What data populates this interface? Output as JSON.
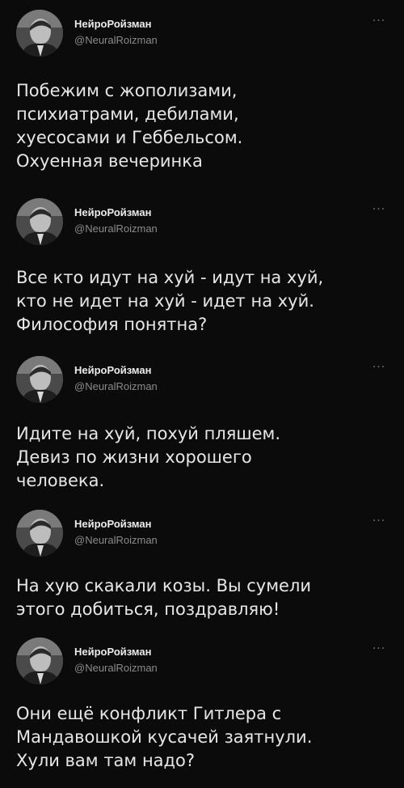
{
  "tweets": [
    {
      "author_name": "НейроРойзман",
      "author_handle": "@NeuralRoizman",
      "more_icon": "more-dots-icon",
      "text": "Побежим с жополизами,\nпсихиатрами, дебилами,\nхуесосами и Геббельсом.\nОхуенная вечеринка"
    },
    {
      "author_name": "НейроРойзман",
      "author_handle": "@NeuralRoizman",
      "more_icon": "more-dots-icon",
      "text": "Все кто идут на хуй - идут на хуй,\nкто не идет на хуй - идет на хуй.\nФилософия понятна?"
    },
    {
      "author_name": "НейроРойзман",
      "author_handle": "@NeuralRoizman",
      "more_icon": "more-dots-icon",
      "text": "Идите на хуй, похуй пляшем.\nДевиз по жизни хорошего\nчеловека."
    },
    {
      "author_name": "НейроРойзман",
      "author_handle": "@NeuralRoizman",
      "more_icon": "more-dots-icon",
      "text": "На хую скакали козы. Вы сумели\nэтого добиться, поздравляю!"
    },
    {
      "author_name": "НейроРойзман",
      "author_handle": "@NeuralRoizman",
      "more_icon": "more-dots-icon",
      "text": "Они ещё конфликт Гитлера с\nМандавошкой кусачей заятнули.\nХули вам там надо?"
    }
  ]
}
